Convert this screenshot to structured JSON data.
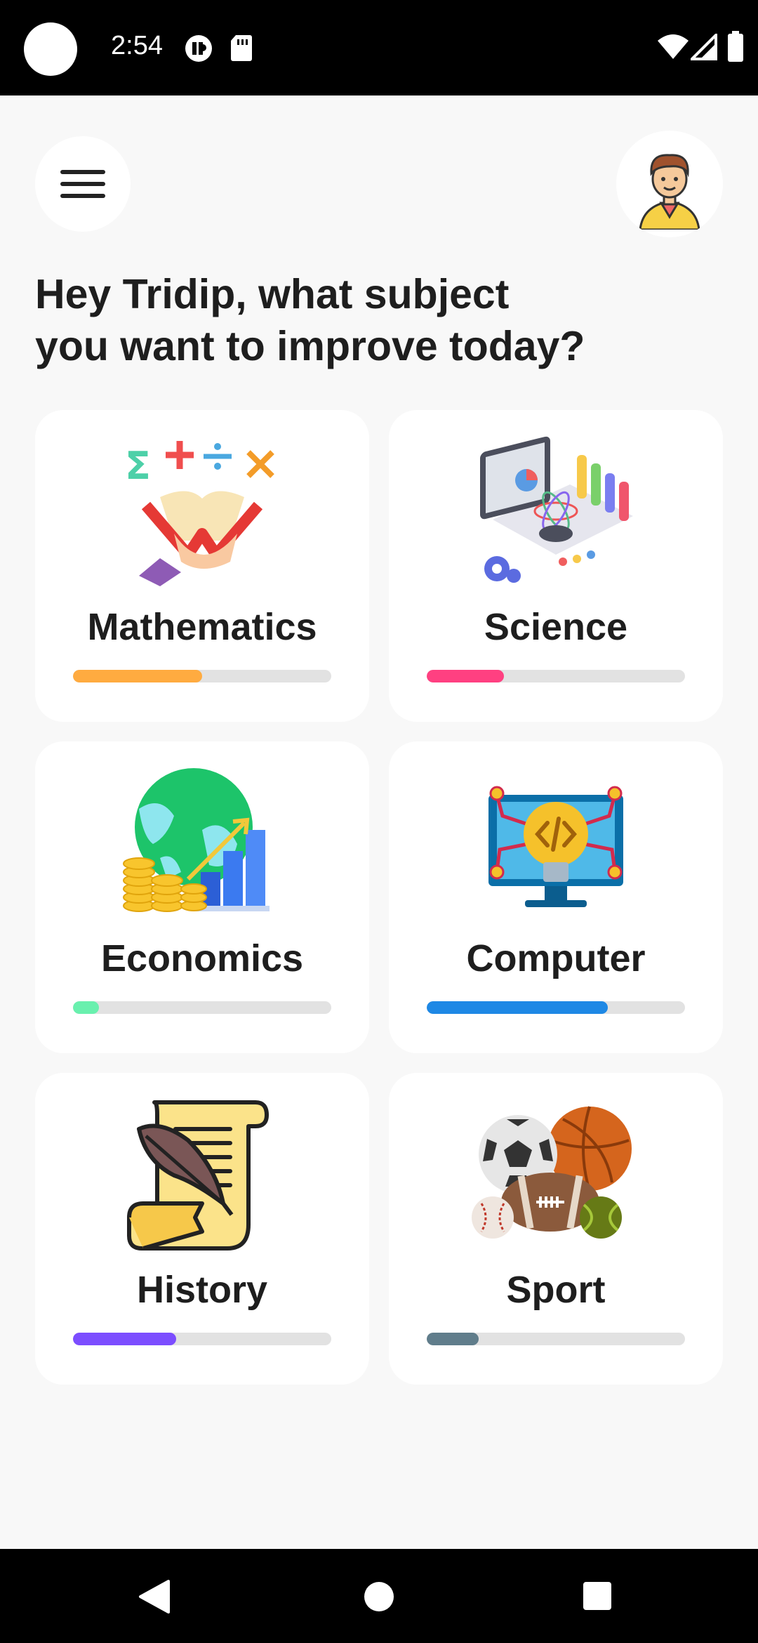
{
  "status_bar": {
    "time": "2:54",
    "icons": [
      "camera-dot-icon",
      "data-saver-icon",
      "sd-card-icon",
      "wifi-icon",
      "signal-icon",
      "battery-icon"
    ]
  },
  "header": {
    "menu_icon": "hamburger-menu-icon",
    "avatar_icon": "user-avatar-icon"
  },
  "greeting": {
    "line1": "Hey Tridip, what subject",
    "line2": "you want to improve today?"
  },
  "subjects": [
    {
      "title": "Mathematics",
      "icon": "math-book-icon",
      "progress": 0.5,
      "color": "#ffab40"
    },
    {
      "title": "Science",
      "icon": "science-lab-icon",
      "progress": 0.3,
      "color": "#ff4081"
    },
    {
      "title": "Economics",
      "icon": "globe-coins-chart-icon",
      "progress": 0.1,
      "color": "#69f0ae"
    },
    {
      "title": "Computer",
      "icon": "code-bulb-monitor-icon",
      "progress": 0.7,
      "color": "#1e88e5"
    },
    {
      "title": "History",
      "icon": "scroll-quill-icon",
      "progress": 0.4,
      "color": "#7c4dff"
    },
    {
      "title": "Sport",
      "icon": "sports-balls-icon",
      "progress": 0.2,
      "color": "#607d8b"
    }
  ],
  "nav": {
    "back": "back-triangle-icon",
    "home": "home-circle-icon",
    "recents": "recents-square-icon"
  }
}
